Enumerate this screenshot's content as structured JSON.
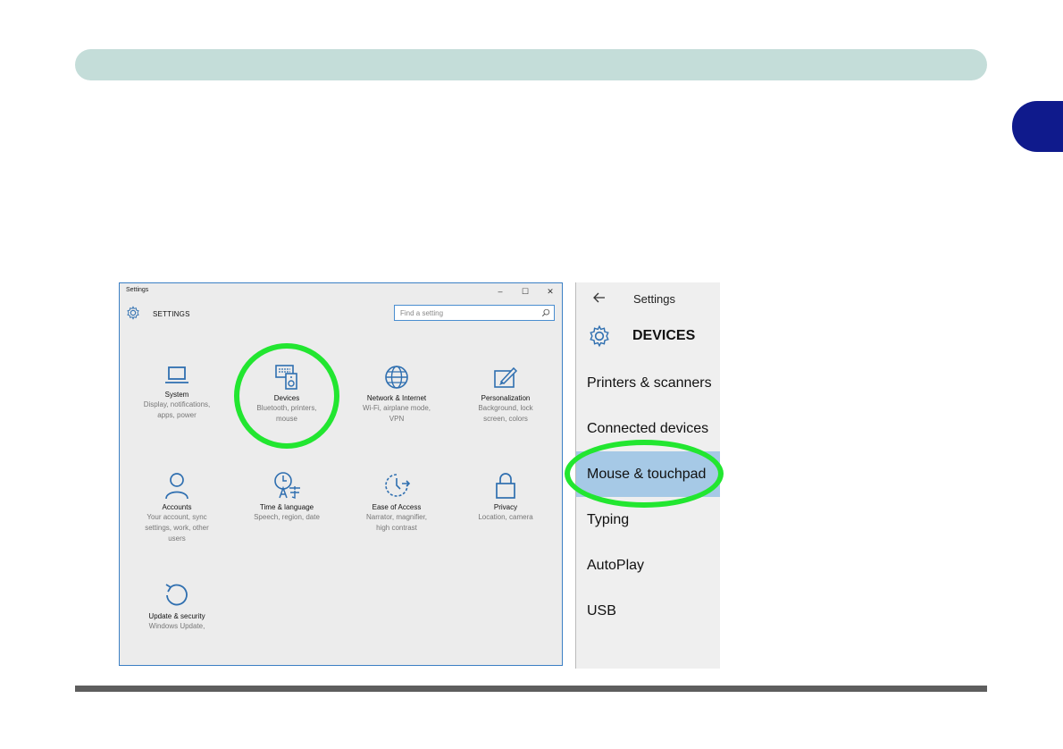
{
  "settings_window": {
    "title": "Settings",
    "controls": {
      "minimize": "–",
      "maximize": "☐",
      "close": "✕"
    },
    "header_title": "SETTINGS",
    "search_placeholder": "Find a setting",
    "tiles": [
      {
        "title": "System",
        "desc": [
          "Display, notifications,",
          "apps, power"
        ],
        "icon": "laptop-icon"
      },
      {
        "title": "Devices",
        "desc": [
          "Bluetooth, printers,",
          "mouse"
        ],
        "icon": "devices-icon"
      },
      {
        "title": "Network & Internet",
        "desc": [
          "Wi-Fi, airplane mode,",
          "VPN"
        ],
        "icon": "globe-icon"
      },
      {
        "title": "Personalization",
        "desc": [
          "Background, lock",
          "screen, colors"
        ],
        "icon": "paint-icon"
      },
      {
        "title": "Accounts",
        "desc": [
          "Your account, sync",
          "settings, work, other",
          "users"
        ],
        "icon": "person-icon"
      },
      {
        "title": "Time & language",
        "desc": [
          "Speech, region, date"
        ],
        "icon": "time-language-icon"
      },
      {
        "title": "Ease of Access",
        "desc": [
          "Narrator, magnifier,",
          "high contrast"
        ],
        "icon": "ease-of-access-icon"
      },
      {
        "title": "Privacy",
        "desc": [
          "Location, camera"
        ],
        "icon": "lock-icon"
      },
      {
        "title": "Update & security",
        "desc": [
          "Windows Update,"
        ],
        "icon": "update-icon"
      }
    ]
  },
  "devices_pane": {
    "back_label": "Settings",
    "title": "DEVICES",
    "items": [
      "Printers & scanners",
      "Connected devices",
      "Mouse & touchpad",
      "Typing",
      "AutoPlay",
      "USB"
    ],
    "selected": "Mouse & touchpad"
  },
  "colors": {
    "header_bar": "#c4ddd9",
    "chapter_tab": "#0f1a8c",
    "highlight_ring": "#22e630",
    "selected_item": "#a6c9e6",
    "window_border": "#3b7fc4"
  }
}
